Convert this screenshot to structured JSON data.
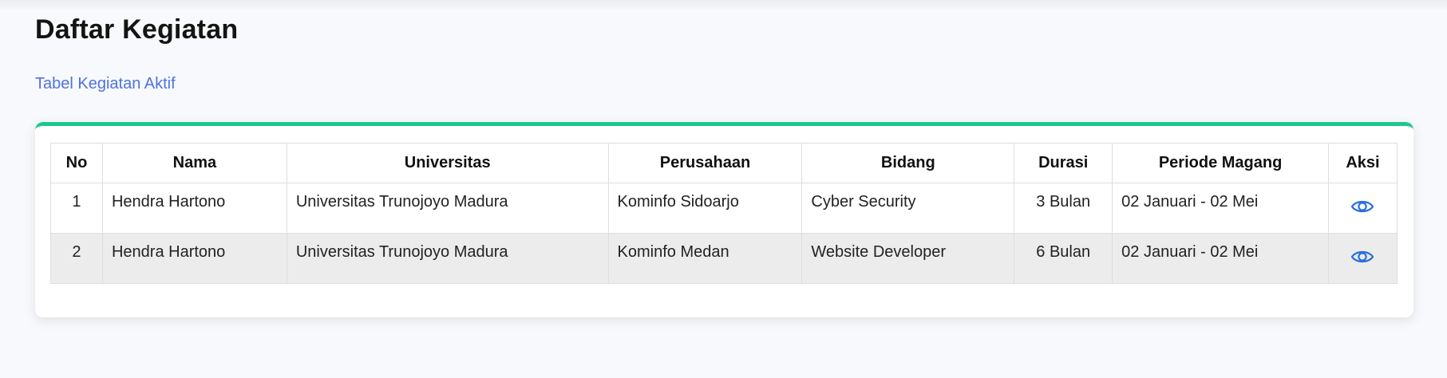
{
  "page": {
    "title": "Daftar Kegiatan",
    "subtitle": "Tabel Kegiatan Aktif"
  },
  "colors": {
    "accent": "#4e73df",
    "card_top_border": "#1cc88a",
    "icon": "#2a6ede"
  },
  "table": {
    "headers": [
      "No",
      "Nama",
      "Universitas",
      "Perusahaan",
      "Bidang",
      "Durasi",
      "Periode Magang",
      "Aksi"
    ],
    "rows": [
      {
        "no": "1",
        "nama": "Hendra Hartono",
        "universitas": "Universitas Trunojoyo Madura",
        "perusahaan": "Kominfo Sidoarjo",
        "bidang": "Cyber Security",
        "durasi": "3 Bulan",
        "periode": "02 Januari - 02 Mei",
        "aksi_icon": "eye-icon"
      },
      {
        "no": "2",
        "nama": "Hendra Hartono",
        "universitas": "Universitas Trunojoyo Madura",
        "perusahaan": "Kominfo Medan",
        "bidang": "Website Developer",
        "durasi": "6 Bulan",
        "periode": "02 Januari - 02 Mei",
        "aksi_icon": "eye-icon"
      }
    ]
  }
}
